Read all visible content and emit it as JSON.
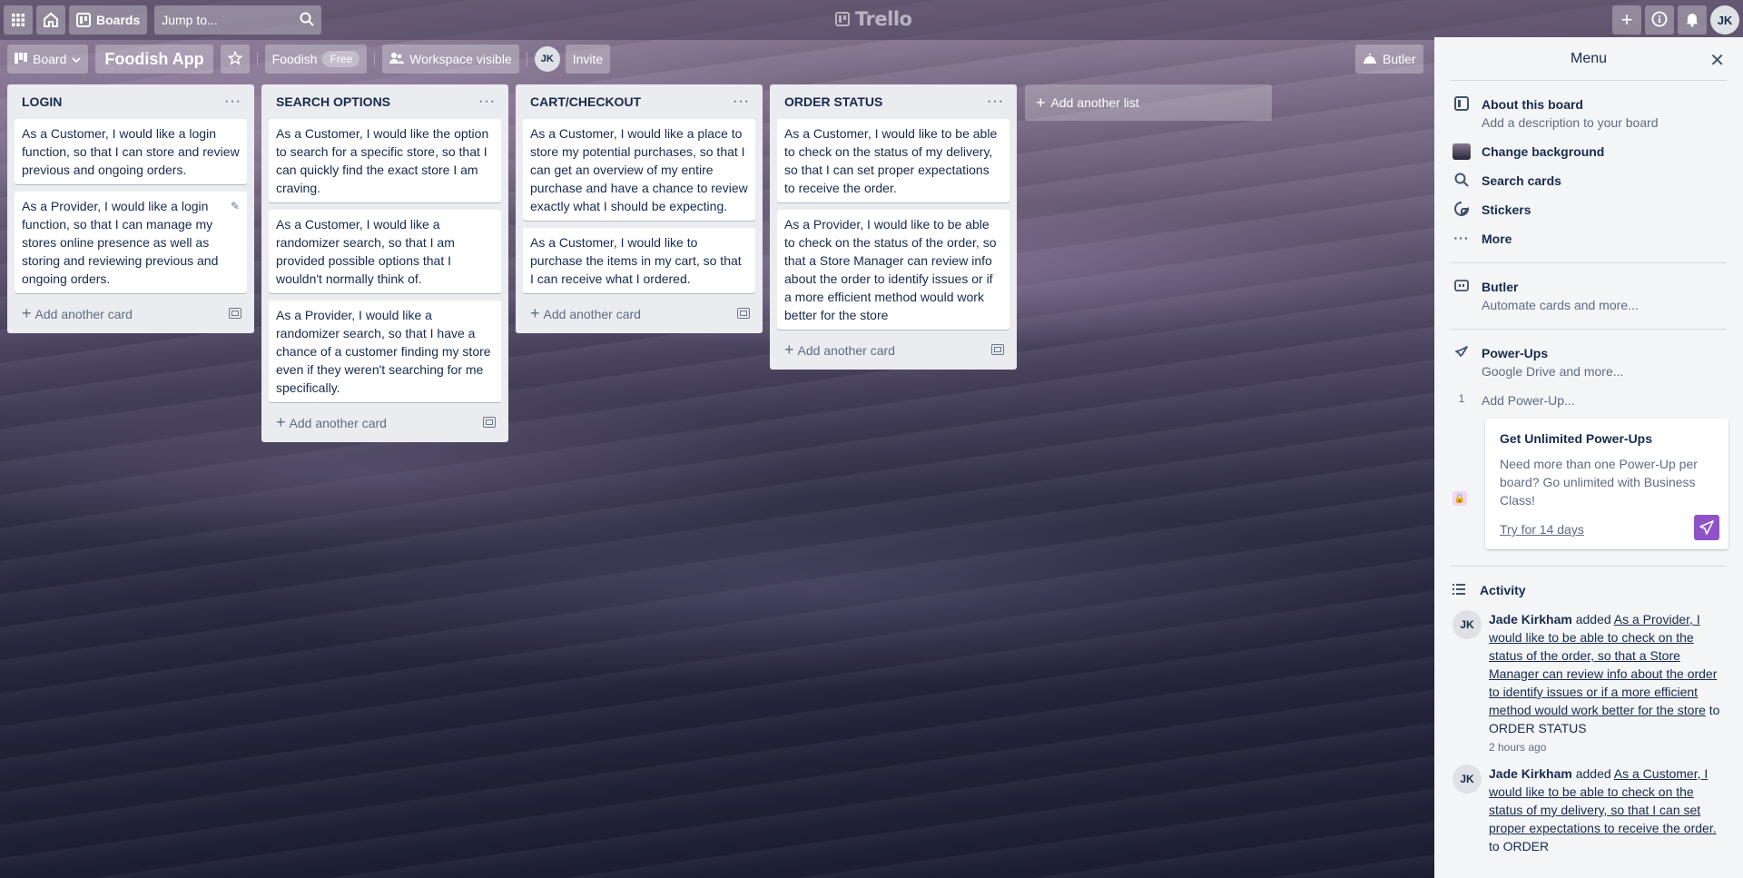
{
  "topbar": {
    "boards_label": "Boards",
    "jump_placeholder": "Jump to...",
    "logo_text": "Trello",
    "user_initials": "JK"
  },
  "board_header": {
    "view_label": "Board",
    "board_name": "Foodish App",
    "workspace_name": "Foodish",
    "workspace_plan": "Free",
    "visibility_label": "Workspace visible",
    "member_initials": "JK",
    "invite_label": "Invite",
    "butler_label": "Butler"
  },
  "lists": [
    {
      "title": "LOGIN",
      "cards": [
        "As a Customer, I would like a login function, so that I can store and review previous and ongoing orders.",
        "As a Provider, I would like a login function, so that I can manage my stores online presence as well as storing and reviewing previous and ongoing orders."
      ],
      "add_card_label": "Add another card"
    },
    {
      "title": "SEARCH OPTIONS",
      "cards": [
        "As a Customer, I would like the option to search for a specific store, so that I can quickly find the exact store I am craving.",
        "As a Customer, I would like a randomizer search, so that I am provided possible options that I wouldn't normally think of.",
        "As a Provider, I would like a randomizer search, so that I have a chance of a customer finding my store even if they weren't searching for me specifically."
      ],
      "add_card_label": "Add another card"
    },
    {
      "title": "CART/CHECKOUT",
      "cards": [
        "As a Customer, I would like a place to store my potential purchases, so that I can get an overview of my entire purchase and have a chance to review exactly what I should be expecting.",
        "As a Customer, I would like to purchase the items in my cart, so that I can receive what I ordered."
      ],
      "add_card_label": "Add another card"
    },
    {
      "title": "ORDER STATUS",
      "cards": [
        "As a Customer, I would like to be able to check on the status of my delivery, so that I can set proper expectations to receive the order.",
        "As a Provider, I would like to be able to check on the status of the order, so that a Store Manager can review info about the order to identify issues or if a more efficient method would work better for the store"
      ],
      "add_card_label": "Add another card"
    }
  ],
  "add_list_label": "Add another list",
  "menu": {
    "title": "Menu",
    "about_label": "About this board",
    "about_sub": "Add a description to your board",
    "change_bg_label": "Change background",
    "search_cards_label": "Search cards",
    "stickers_label": "Stickers",
    "more_label": "More",
    "butler_label": "Butler",
    "butler_sub": "Automate cards and more...",
    "powerups_label": "Power-Ups",
    "powerups_sub": "Google Drive and more...",
    "powerup_count": "1",
    "add_powerup_label": "Add Power-Up...",
    "upsell_title": "Get Unlimited Power-Ups",
    "upsell_body": "Need more than one Power-Up per board? Go unlimited with Business Class!",
    "upsell_link": "Try for 14 days",
    "activity_label": "Activity",
    "activity": [
      {
        "initials": "JK",
        "user": "Jade Kirkham",
        "verb": "added",
        "link": "As a Provider, I would like to be able to check on the status of the order, so that a Store Manager can review info about the order to identify issues or if a more efficient method would work better for the store",
        "suffix": "to ORDER STATUS",
        "time": "2 hours ago"
      },
      {
        "initials": "JK",
        "user": "Jade Kirkham",
        "verb": "added",
        "link": "As a Customer, I would like to be able to check on the status of my delivery, so that I can set proper expectations to receive the order.",
        "suffix": "to ORDER",
        "time": ""
      }
    ]
  }
}
